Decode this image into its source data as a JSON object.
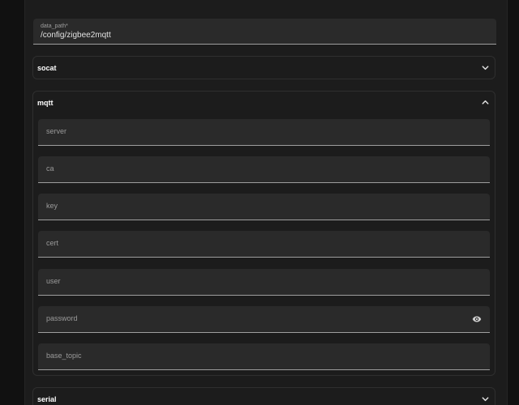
{
  "data_path": {
    "label": "data_path*",
    "value": "/config/zigbee2mqtt"
  },
  "socat": {
    "title": "socat",
    "icon": "chevron-down-icon"
  },
  "mqtt": {
    "title": "mqtt",
    "icon": "chevron-up-icon",
    "fields": [
      {
        "placeholder": "server"
      },
      {
        "placeholder": "ca"
      },
      {
        "placeholder": "key"
      },
      {
        "placeholder": "cert"
      },
      {
        "placeholder": "user"
      },
      {
        "placeholder": "password",
        "icon": "eye-icon"
      },
      {
        "placeholder": "base_topic"
      }
    ]
  },
  "serial": {
    "title": "serial",
    "icon": "chevron-down-icon"
  },
  "colors": {
    "background": "#111111",
    "card": "#1c1c1c",
    "field": "#2a2a2a",
    "text": "#e1e1e1",
    "muted": "#9a9a9a"
  }
}
